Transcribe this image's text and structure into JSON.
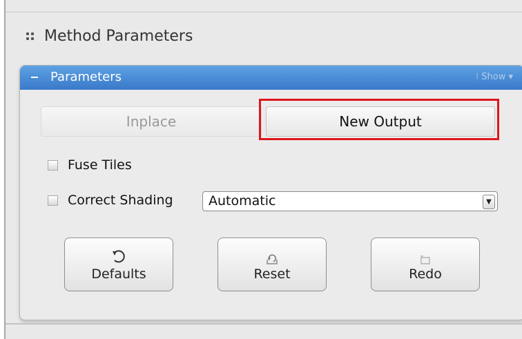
{
  "section": {
    "title": "Method Parameters"
  },
  "panel": {
    "title": "Parameters",
    "show_label": "Show"
  },
  "mode": {
    "inplace_label": "Inplace",
    "new_output_label": "New Output",
    "selected": "New Output"
  },
  "options": {
    "fuse_tiles": {
      "label": "Fuse Tiles",
      "checked": false
    },
    "correct_shading": {
      "label": "Correct Shading",
      "checked": false,
      "value": "Automatic"
    }
  },
  "actions": {
    "defaults_label": "Defaults",
    "reset_label": "Reset",
    "redo_label": "Redo"
  },
  "colors": {
    "header_blue": "#3979c9",
    "highlight_red": "#e0141b"
  },
  "icons": {
    "section": "grip-icon",
    "collapse": "minus-icon",
    "defaults": "undo-arrow-icon",
    "reset": "reset-icon",
    "redo": "redo-icon",
    "dropdown": "chevron-down-icon"
  }
}
